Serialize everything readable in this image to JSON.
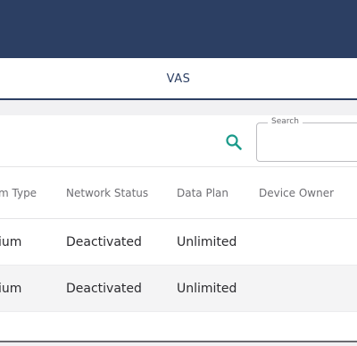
{
  "tabs": {
    "vas": "VAS"
  },
  "search": {
    "label": "Search",
    "value": ""
  },
  "table": {
    "columns": [
      "m Type",
      "Network Status",
      "Data Plan",
      "Device Owner"
    ],
    "rows": [
      [
        "ium",
        "Deactivated",
        "Unlimited",
        ""
      ],
      [
        "ium",
        "Deactivated",
        "Unlimited",
        ""
      ]
    ]
  },
  "colors": {
    "header": "#2c3f63",
    "accent": "#1a9a8a"
  }
}
